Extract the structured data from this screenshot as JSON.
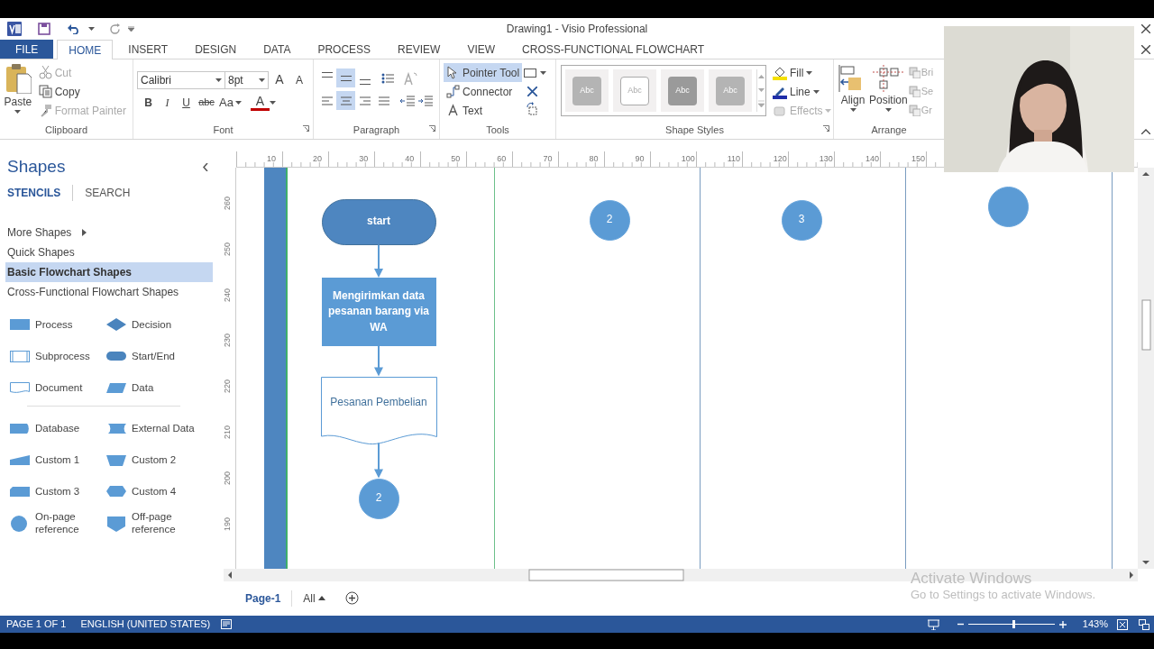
{
  "window": {
    "title": "Drawing1 - Visio Professional"
  },
  "ribbon_tabs": [
    {
      "label": "FILE",
      "kind": "file",
      "selected": false
    },
    {
      "label": "HOME",
      "kind": "tab",
      "selected": true
    },
    {
      "label": "INSERT",
      "kind": "tab",
      "selected": false
    },
    {
      "label": "DESIGN",
      "kind": "tab",
      "selected": false
    },
    {
      "label": "DATA",
      "kind": "tab",
      "selected": false
    },
    {
      "label": "PROCESS",
      "kind": "tab",
      "selected": false
    },
    {
      "label": "REVIEW",
      "kind": "tab",
      "selected": false
    },
    {
      "label": "VIEW",
      "kind": "tab",
      "selected": false
    },
    {
      "label": "CROSS-FUNCTIONAL FLOWCHART",
      "kind": "tab",
      "selected": false
    }
  ],
  "ribbon": {
    "clipboard": {
      "label": "Clipboard",
      "paste": "Paste",
      "items": [
        {
          "label": "Cut",
          "kind": "cut",
          "disabled": true
        },
        {
          "label": "Copy",
          "kind": "copy",
          "disabled": false
        },
        {
          "label": "Format Painter",
          "kind": "painter",
          "disabled": true
        }
      ]
    },
    "font": {
      "label": "Font",
      "font_name": "Calibri",
      "font_size": "8pt",
      "size_buttons": [
        "A",
        "A"
      ],
      "format_buttons": [
        {
          "label": "B",
          "kind": "bold"
        },
        {
          "label": "I",
          "kind": "italic"
        },
        {
          "label": "U",
          "kind": "underline"
        },
        {
          "label": "abc",
          "kind": "strike"
        },
        {
          "label": "Aa",
          "kind": "case"
        }
      ],
      "color_button": "A"
    },
    "paragraph": {
      "label": "Paragraph",
      "vertical_align": [
        {
          "selected": false
        },
        {
          "selected": true
        },
        {
          "selected": false
        }
      ],
      "horizontal_align": [
        {
          "selected": false
        },
        {
          "selected": true
        },
        {
          "selected": false
        },
        {
          "selected": false
        }
      ]
    },
    "tools": {
      "label": "Tools",
      "items": [
        {
          "label": "Pointer Tool",
          "kind": "pointer",
          "selected": true
        },
        {
          "label": "Connector",
          "kind": "connector",
          "selected": false
        },
        {
          "label": "Text",
          "kind": "text",
          "selected": false
        }
      ]
    },
    "shape_styles": {
      "label": "Shape Styles",
      "styles": [
        {
          "label": "Abc",
          "kind": "filled"
        },
        {
          "label": "Abc",
          "kind": "outline"
        },
        {
          "label": "Abc",
          "kind": "dark"
        },
        {
          "label": "Abc",
          "kind": "filled"
        }
      ],
      "items": [
        {
          "label": "Fill",
          "kind": "fill",
          "disabled": false
        },
        {
          "label": "Line",
          "kind": "line",
          "disabled": false
        },
        {
          "label": "Effects",
          "kind": "effects",
          "disabled": true
        }
      ]
    },
    "arrange": {
      "label": "Arrange",
      "items": [
        {
          "label": "Align",
          "kind": "align"
        },
        {
          "label": "Position",
          "kind": "position"
        }
      ],
      "small_items": [
        "Bri",
        "Se",
        "Gr"
      ]
    }
  },
  "shapes_panel": {
    "title": "Shapes",
    "tabs": [
      {
        "label": "STENCILS",
        "selected": true
      },
      {
        "label": "SEARCH",
        "selected": false
      }
    ],
    "stencils": [
      {
        "label": "More Shapes",
        "kind": "menu",
        "selected": false
      },
      {
        "label": "Quick Shapes",
        "kind": "item",
        "selected": false
      },
      {
        "label": "Basic Flowchart Shapes",
        "kind": "item",
        "selected": true
      },
      {
        "label": "Cross-Functional Flowchart Shapes",
        "kind": "item",
        "selected": false
      }
    ],
    "shape_groups": [
      [
        {
          "label": "Process",
          "kind": "process"
        },
        {
          "label": "Decision",
          "kind": "decision"
        },
        {
          "label": "Subprocess",
          "kind": "subprocess"
        },
        {
          "label": "Start/End",
          "kind": "startend"
        },
        {
          "label": "Document",
          "kind": "document"
        },
        {
          "label": "Data",
          "kind": "data"
        }
      ],
      [
        {
          "label": "Database",
          "kind": "database"
        },
        {
          "label": "External Data",
          "kind": "external"
        },
        {
          "label": "Custom 1",
          "kind": "custom1"
        },
        {
          "label": "Custom 2",
          "kind": "custom2"
        },
        {
          "label": "Custom 3",
          "kind": "custom3"
        },
        {
          "label": "Custom 4",
          "kind": "custom4"
        },
        {
          "label": "On-page reference",
          "kind": "onpage"
        },
        {
          "label": "Off-page reference",
          "kind": "offpage"
        }
      ]
    ]
  },
  "rulers": {
    "horizontal": [
      "10",
      "20",
      "30",
      "40",
      "50",
      "60",
      "70",
      "80",
      "90",
      "100",
      "110",
      "120",
      "130",
      "140",
      "150"
    ],
    "vertical": [
      "260",
      "250",
      "240",
      "230",
      "220",
      "210",
      "200",
      "190"
    ]
  },
  "canvas": {
    "lanes": [
      {
        "nodes": [
          {
            "kind": "terminal",
            "text": "start"
          },
          {
            "kind": "process",
            "text": "Mengirimkan data pesanan barang via WA"
          },
          {
            "kind": "document",
            "text": "Pesanan Pembelian"
          },
          {
            "kind": "onpage",
            "text": "2"
          }
        ]
      },
      {
        "nodes": [
          {
            "kind": "onpage",
            "text": "2"
          }
        ]
      },
      {
        "nodes": [
          {
            "kind": "onpage",
            "text": "3"
          }
        ]
      },
      {
        "nodes": [
          {
            "kind": "onpage"
          }
        ]
      }
    ]
  },
  "page_tabs": [
    {
      "label": "Page-1",
      "kind": "page",
      "selected": true
    },
    {
      "label": "All",
      "kind": "all",
      "selected": false
    }
  ],
  "activation_notice": {
    "title": "Activate Windows",
    "text": "Go to Settings to activate Windows."
  },
  "status_bar": {
    "page": "PAGE 1 OF 1",
    "language": "ENGLISH (UNITED STATES)",
    "zoom": {
      "level": 0.53,
      "reading": "143%"
    }
  }
}
